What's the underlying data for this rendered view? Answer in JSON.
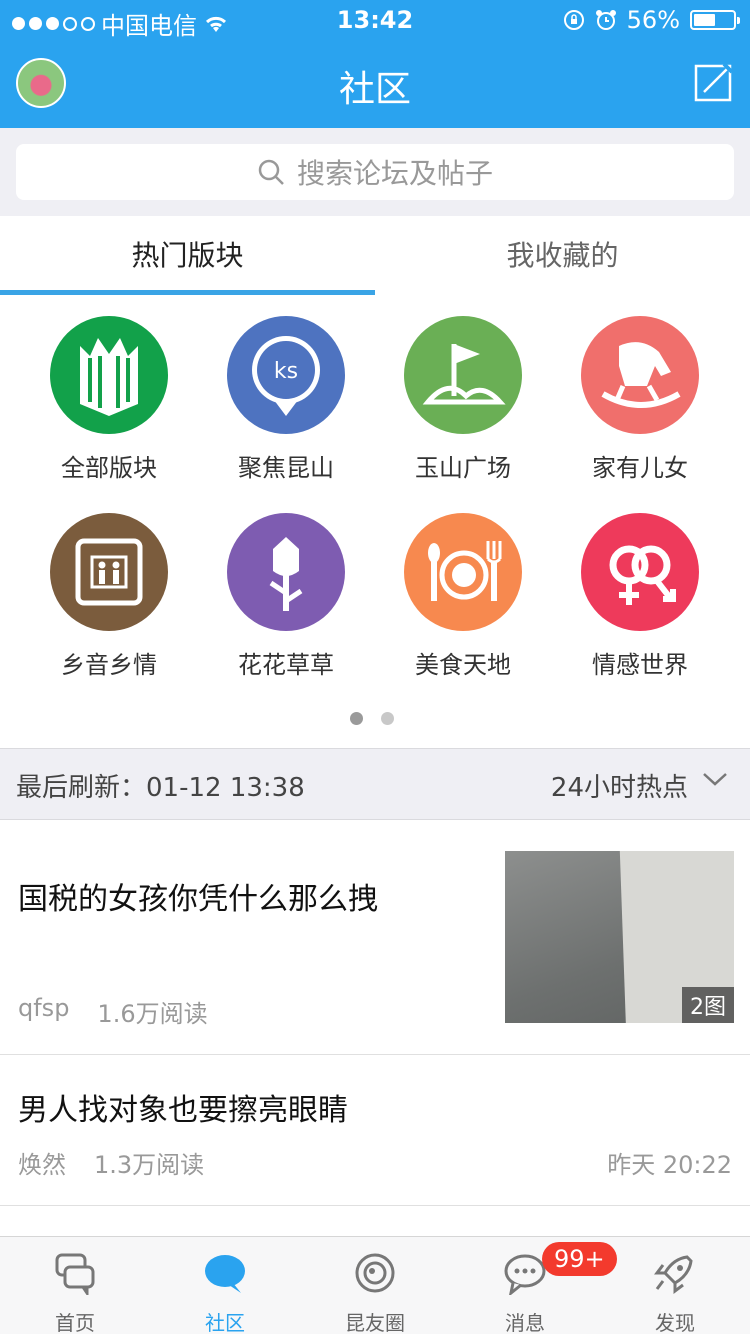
{
  "status": {
    "carrier": "中国电信",
    "time": "13:42",
    "battery": "56%",
    "battery_level": 0.56
  },
  "header": {
    "title": "社区"
  },
  "search": {
    "placeholder": "搜索论坛及帖子"
  },
  "tabs": [
    {
      "label": "热门版块",
      "active": true
    },
    {
      "label": "我收藏的",
      "active": false
    }
  ],
  "forums": [
    {
      "label": "全部版块",
      "icon": "book-icon",
      "color": "#12a14a"
    },
    {
      "label": "聚焦昆山",
      "icon": "location-pin-icon",
      "color": "#4e73c0",
      "pin_text": "ks"
    },
    {
      "label": "玉山广场",
      "icon": "flag-hill-icon",
      "color": "#6aaf55"
    },
    {
      "label": "家有儿女",
      "icon": "rocking-horse-icon",
      "color": "#f06f6c"
    },
    {
      "label": "乡音乡情",
      "icon": "elevator-people-icon",
      "color": "#7b5c3d"
    },
    {
      "label": "花花草草",
      "icon": "flower-icon",
      "color": "#7e5cb1"
    },
    {
      "label": "美食天地",
      "icon": "dining-icon",
      "color": "#f7894f"
    },
    {
      "label": "情感世界",
      "icon": "gender-rings-icon",
      "color": "#ee3a5b"
    }
  ],
  "pager": {
    "current": 1,
    "total": 2
  },
  "refresh": {
    "prefix": "最后刷新：",
    "datetime": "01-12  13:38",
    "filter": "24小时热点"
  },
  "posts": [
    {
      "title": "国税的女孩你凭什么那么拽",
      "author": "qfsp",
      "reads": "1.6万阅读",
      "image_count": "2图"
    },
    {
      "title": "男人找对象也要擦亮眼睛",
      "author": "焕然",
      "reads": "1.3万阅读",
      "time": "昨天 20:22"
    }
  ],
  "tabbar": [
    {
      "label": "首页",
      "icon": "home-chat-icon"
    },
    {
      "label": "社区",
      "icon": "community-bubble-icon",
      "active": true
    },
    {
      "label": "昆友圈",
      "icon": "circle-eye-icon"
    },
    {
      "label": "消息",
      "icon": "message-icon",
      "badge": "99+"
    },
    {
      "label": "发现",
      "icon": "rocket-icon"
    }
  ]
}
